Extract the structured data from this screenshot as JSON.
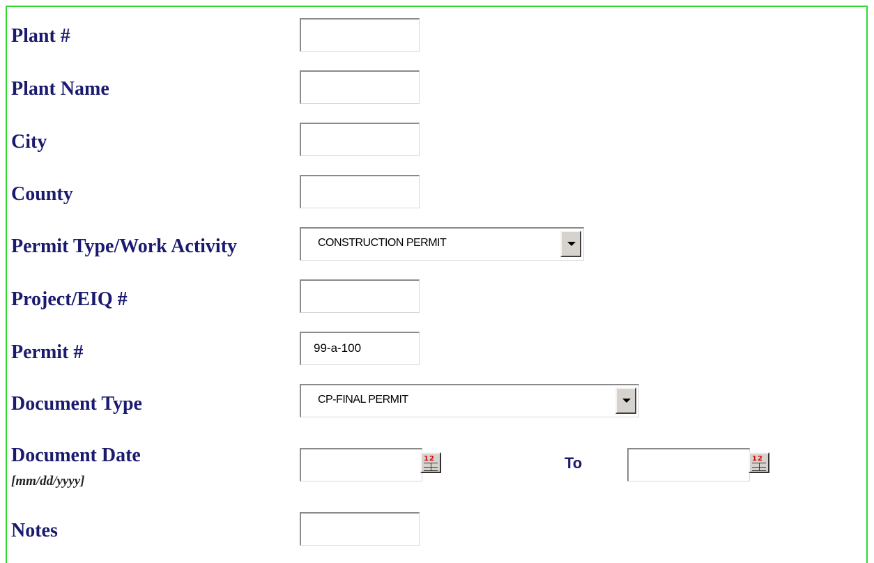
{
  "form": {
    "labels": {
      "plant_num": "Plant #",
      "plant_name": "Plant Name",
      "city": "City",
      "county": "County",
      "permit_type": "Permit Type/Work Activity",
      "project_eiq": "Project/EIQ #",
      "permit_num": "Permit #",
      "document_type": "Document Type",
      "document_date": "Document Date",
      "date_format": "[mm/dd/yyyy]",
      "notes": "Notes",
      "to": "To"
    },
    "values": {
      "plant_num": "",
      "plant_name": "",
      "city": "",
      "county": "",
      "permit_type": "CONSTRUCTION PERMIT",
      "project_eiq": "",
      "permit_num": "99-a-100",
      "document_type": "CP-FINAL PERMIT",
      "date_from": "",
      "date_to": "",
      "notes": ""
    },
    "icons": {
      "calendar_glyph": "12"
    }
  },
  "colors": {
    "border": "#2fd92f",
    "label": "#1a1a6e"
  }
}
